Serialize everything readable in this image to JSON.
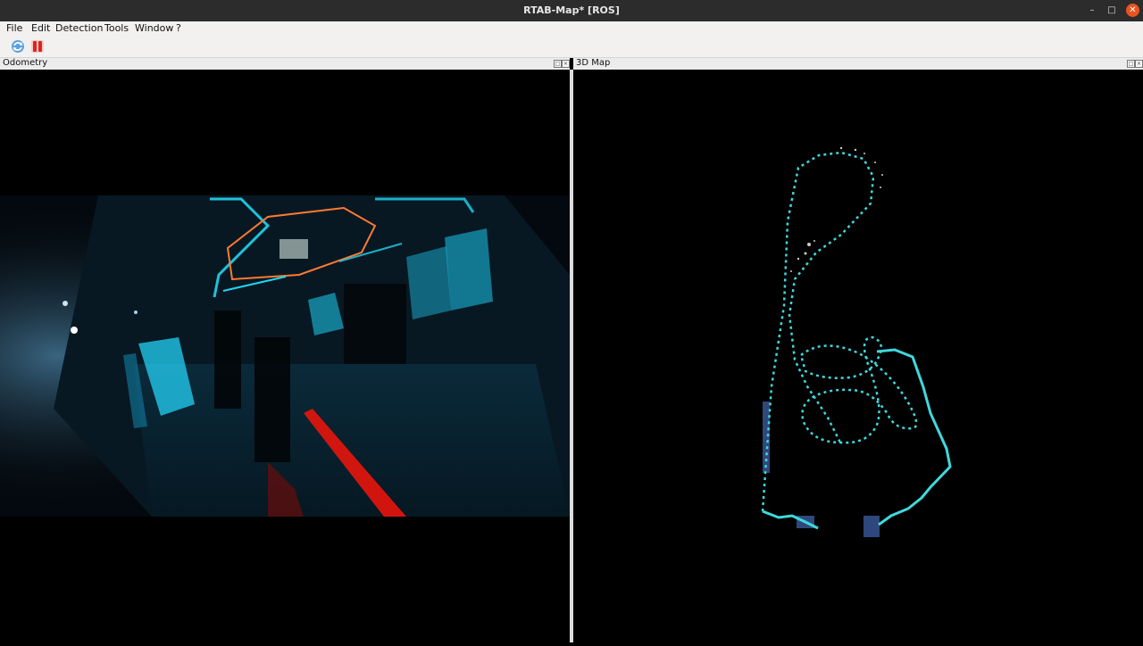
{
  "window": {
    "title": "RTAB-Map* [ROS]"
  },
  "menubar": {
    "items": [
      "File",
      "Edit",
      "Detection",
      "Tools",
      "Window",
      "?"
    ]
  },
  "toolbar": {
    "buttons": [
      {
        "icon": "refresh-icon"
      },
      {
        "icon": "pause-icon"
      }
    ]
  },
  "docks": {
    "odometry": {
      "title": "Odometry"
    },
    "map3d": {
      "title": "3D Map"
    }
  },
  "colors": {
    "trajectory": "#3fd8dc",
    "tron_cyan": "#22d5f0",
    "tron_orange": "#ff7a30",
    "laser_red": "#e8150c",
    "close": "#e95420"
  }
}
